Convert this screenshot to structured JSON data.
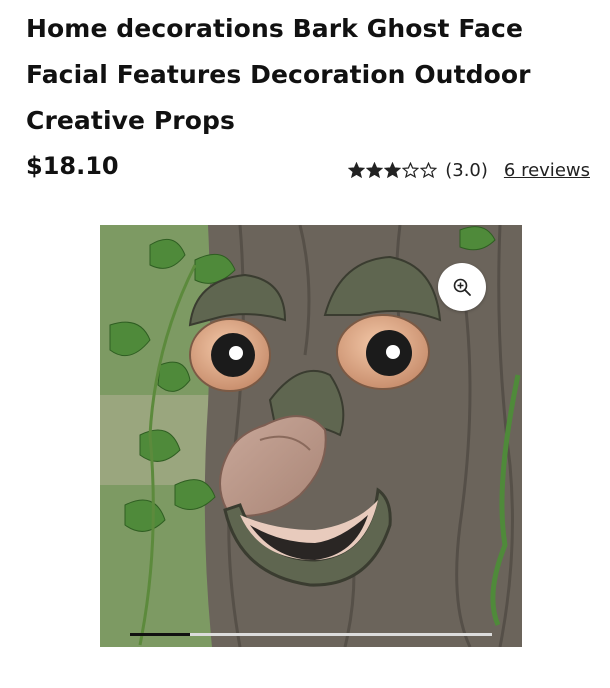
{
  "product": {
    "title": "Home decorations Bark Ghost Face Facial Features Decoration Outdoor Creative Props",
    "price": "$18.10",
    "rating": {
      "stars_filled": 3,
      "stars_total": 5,
      "value_text": "(3.0)",
      "reviews_text": "6 reviews"
    }
  },
  "gallery": {
    "zoom_icon": "zoom-in-icon",
    "scroll_position": 0.17
  },
  "colors": {
    "star": "#222222",
    "scroll_thumb": "#111111",
    "scroll_track": "#dcdcdc"
  }
}
